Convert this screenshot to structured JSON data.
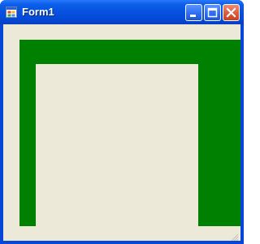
{
  "window": {
    "title": "Form1",
    "app_icon": "application-icon",
    "buttons": {
      "minimize_icon": "minimize-icon",
      "maximize_icon": "maximize-icon",
      "close_icon": "close-icon"
    }
  },
  "client": {
    "background_color": "#ece9d8",
    "frame_color": "#008000",
    "inner_panel_color": "#ece9d8"
  },
  "theme": {
    "titlebar_color": "#0653df",
    "window_border_color": "#0846d8",
    "close_button_color": "#dc5a3d"
  }
}
